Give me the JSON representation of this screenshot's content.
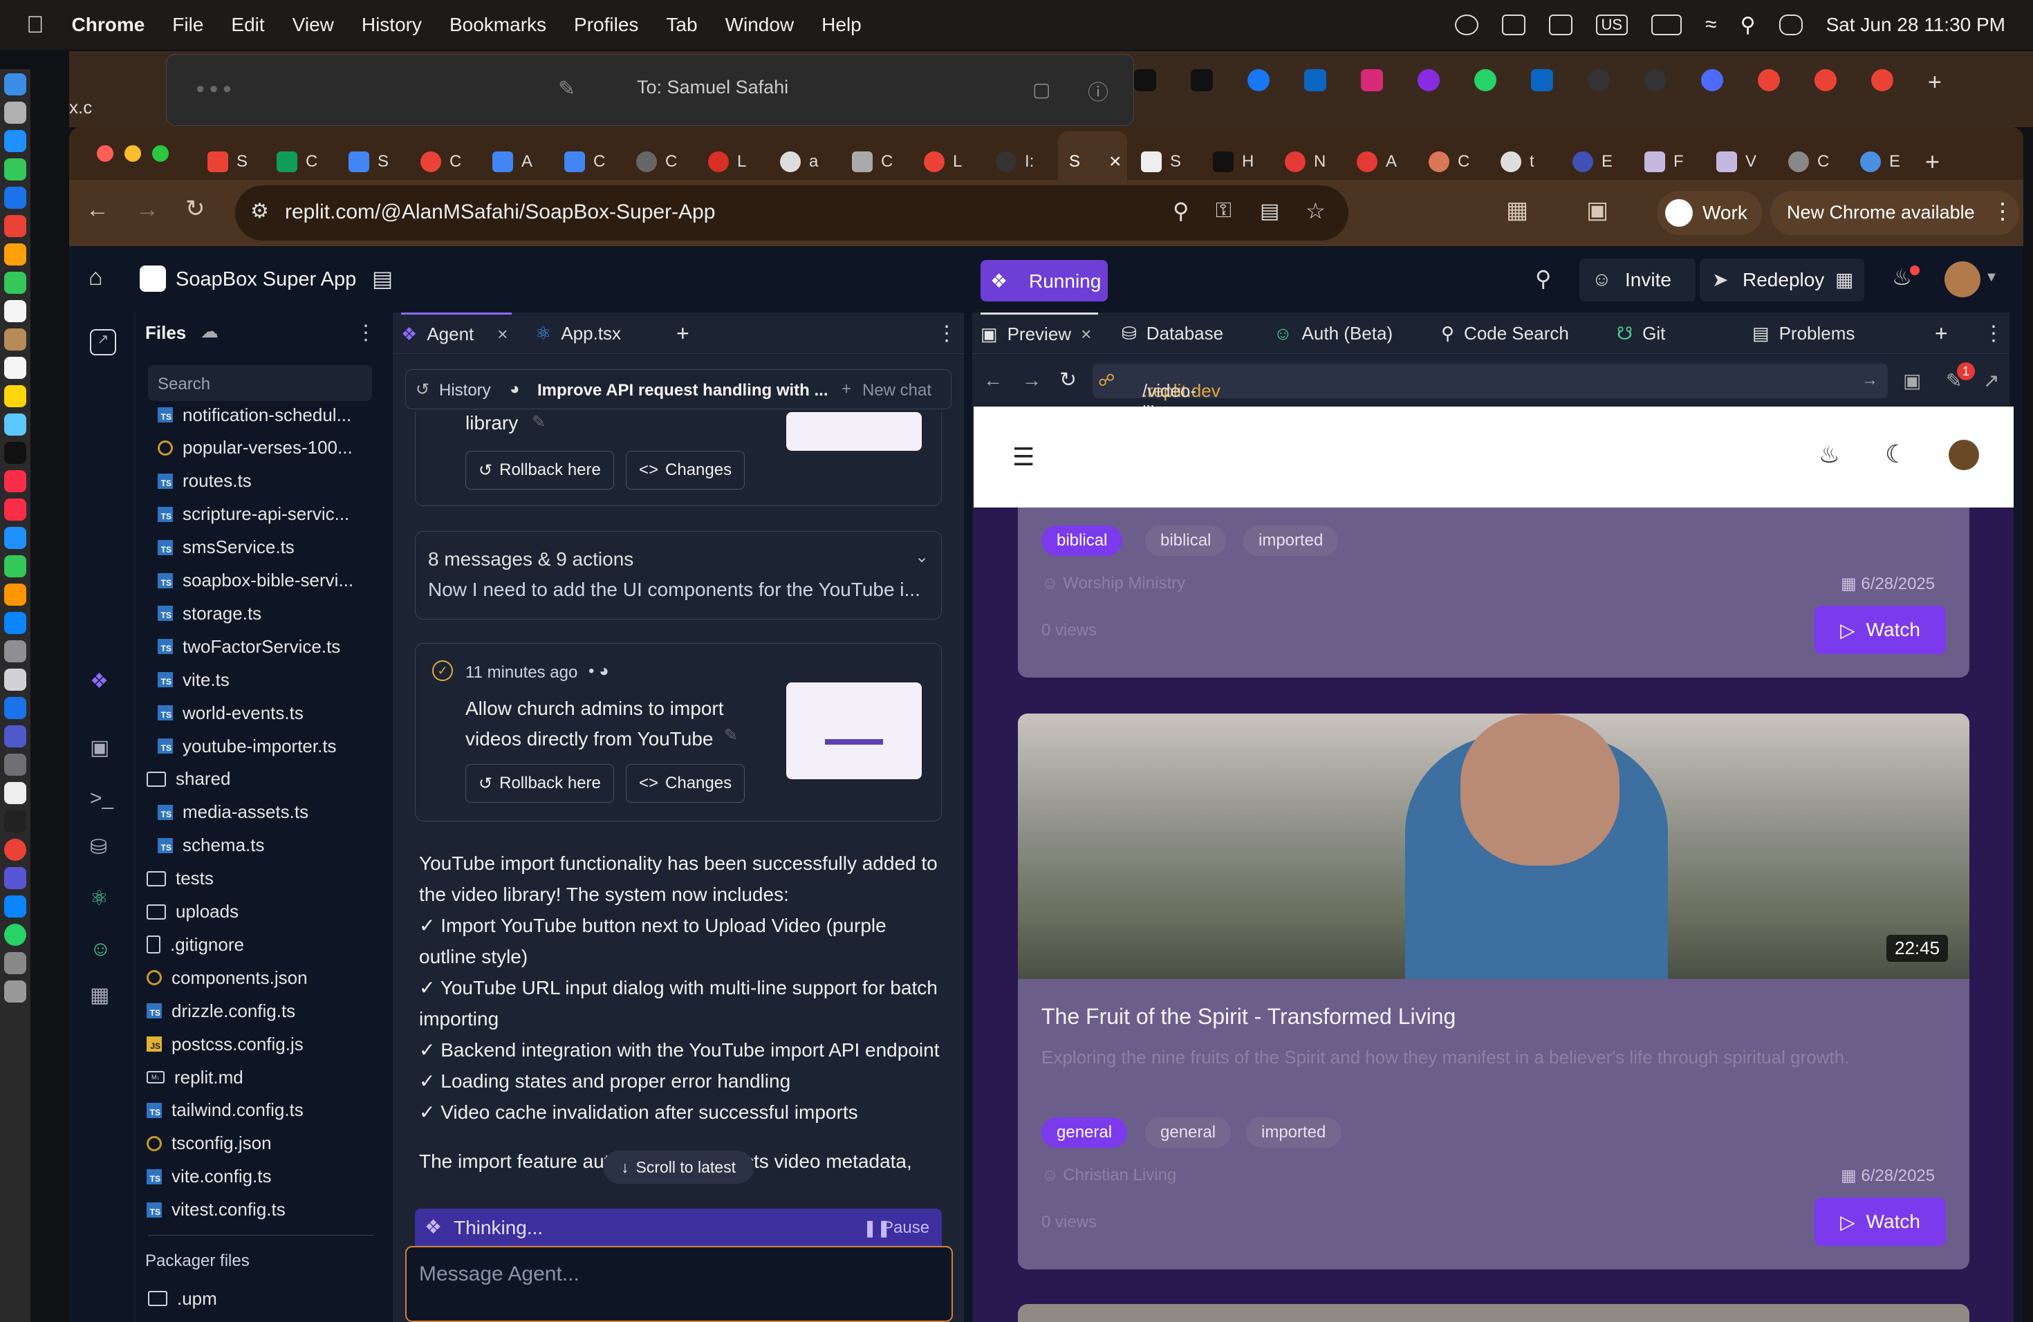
{
  "menubar": {
    "app": "Chrome",
    "items": [
      "File",
      "Edit",
      "View",
      "History",
      "Bookmarks",
      "Profiles",
      "Tab",
      "Window",
      "Help"
    ],
    "keyboard": "US",
    "datetime": "Sat Jun 28  11:30 PM"
  },
  "background_window": {
    "x_tab": "x.c",
    "messages_to_label": "To:",
    "messages_to": "Samuel Safahi"
  },
  "browser": {
    "url": "replit.com/@AlanMSafahi/SoapBox-Super-App",
    "profile": "Work",
    "update": "New Chrome available",
    "active_tab": "S",
    "tab_letters": [
      "S",
      "C",
      "S",
      "C",
      "A",
      "C",
      "C",
      "L",
      "a",
      "C",
      "L",
      "I:",
      "S",
      "S",
      "H",
      "N",
      "A",
      "C",
      "t",
      "E",
      "F",
      "V",
      "C",
      "E"
    ]
  },
  "replit": {
    "project": "SoapBox Super App",
    "status": "Running",
    "invite": "Invite",
    "redeploy": "Redeploy",
    "files": {
      "title": "Files",
      "search_placeholder": "Search",
      "rows": [
        {
          "name": "notification-schedul...",
          "kind": "ts",
          "indent": 1
        },
        {
          "name": "popular-verses-100...",
          "kind": "ring",
          "indent": 1
        },
        {
          "name": "routes.ts",
          "kind": "ts",
          "indent": 1
        },
        {
          "name": "scripture-api-servic...",
          "kind": "ts",
          "indent": 1
        },
        {
          "name": "smsService.ts",
          "kind": "ts",
          "indent": 1
        },
        {
          "name": "soapbox-bible-servi...",
          "kind": "ts",
          "indent": 1
        },
        {
          "name": "storage.ts",
          "kind": "ts",
          "indent": 1
        },
        {
          "name": "twoFactorService.ts",
          "kind": "ts",
          "indent": 1
        },
        {
          "name": "vite.ts",
          "kind": "ts",
          "indent": 1
        },
        {
          "name": "world-events.ts",
          "kind": "ts",
          "indent": 1
        },
        {
          "name": "youtube-importer.ts",
          "kind": "ts",
          "indent": 1
        },
        {
          "name": "shared",
          "kind": "folder",
          "indent": 0
        },
        {
          "name": "media-assets.ts",
          "kind": "ts",
          "indent": 1
        },
        {
          "name": "schema.ts",
          "kind": "ts",
          "indent": 1
        },
        {
          "name": "tests",
          "kind": "folder",
          "indent": 0
        },
        {
          "name": "uploads",
          "kind": "folder",
          "indent": 0
        },
        {
          "name": ".gitignore",
          "kind": "doc",
          "indent": 0
        },
        {
          "name": "components.json",
          "kind": "ring",
          "indent": 0
        },
        {
          "name": "drizzle.config.ts",
          "kind": "ts",
          "indent": 0
        },
        {
          "name": "postcss.config.js",
          "kind": "js",
          "indent": 0
        },
        {
          "name": "replit.md",
          "kind": "md",
          "indent": 0
        },
        {
          "name": "tailwind.config.ts",
          "kind": "ts",
          "indent": 0
        },
        {
          "name": "tsconfig.json",
          "kind": "ring",
          "indent": 0
        },
        {
          "name": "vite.config.ts",
          "kind": "ts",
          "indent": 0
        },
        {
          "name": "vitest.config.ts",
          "kind": "ts",
          "indent": 0
        }
      ],
      "packager_title": "Packager files",
      "packager_rows": [
        {
          "name": ".upm",
          "kind": "folder"
        }
      ]
    },
    "agent": {
      "tab_agent": "Agent",
      "tab_file": "App.tsx",
      "history": "History",
      "chat_title": "Improve API request handling with ...",
      "new_chat": "New chat",
      "card1_tail": "library",
      "rollback": "Rollback here",
      "changes": "Changes",
      "collapsed_title": "8 messages & 9 actions",
      "collapsed_preview": "Now I need to add the UI components for the YouTube i...",
      "card2_time": "11 minutes ago",
      "card2_text": "Allow church admins to import videos directly from YouTube",
      "message_lines": [
        "YouTube import functionality has been successfully added to the video library! The system now includes:",
        "✓ Import YouTube button next to Upload Video (purple outline style)",
        "✓ YouTube URL input dialog with multi-line support for batch importing",
        "✓ Backend integration with the YouTube import API endpoint",
        "✓ Loading states and proper error handling",
        "✓ Video cache invalidation after successful imports"
      ],
      "message_tail": "The import feature automatically extracts video metadata,",
      "scroll_latest": "Scroll to latest",
      "thinking": "Thinking...",
      "pause": "Pause",
      "input_placeholder": "Message Agent..."
    },
    "preview": {
      "tabs": [
        "Preview",
        "Database",
        "Auth (Beta)",
        "Code Search",
        "Git",
        "Problems"
      ],
      "url_host": ".replit.dev",
      "url_path": "/video-library",
      "badge": "1",
      "videos": [
        {
          "tags": [
            "biblical",
            "biblical",
            "imported"
          ],
          "author": "Worship Ministry",
          "date": "6/28/2025",
          "views": "0 views",
          "watch": "Watch"
        },
        {
          "duration": "22:45",
          "title": "The Fruit of the Spirit - Transformed Living",
          "description": "Exploring the nine fruits of the Spirit and how they manifest in a believer's life through spiritual growth.",
          "tags": [
            "general",
            "general",
            "imported"
          ],
          "author": "Christian Living",
          "date": "6/28/2025",
          "views": "0 views",
          "watch": "Watch"
        }
      ]
    }
  },
  "colors": {
    "replit_bg": "#0e1525",
    "panel_bg": "#1c2333",
    "accent_purple": "#7c3aed",
    "running": "#6d3fd6",
    "chrome_frame": "#4b3421"
  }
}
